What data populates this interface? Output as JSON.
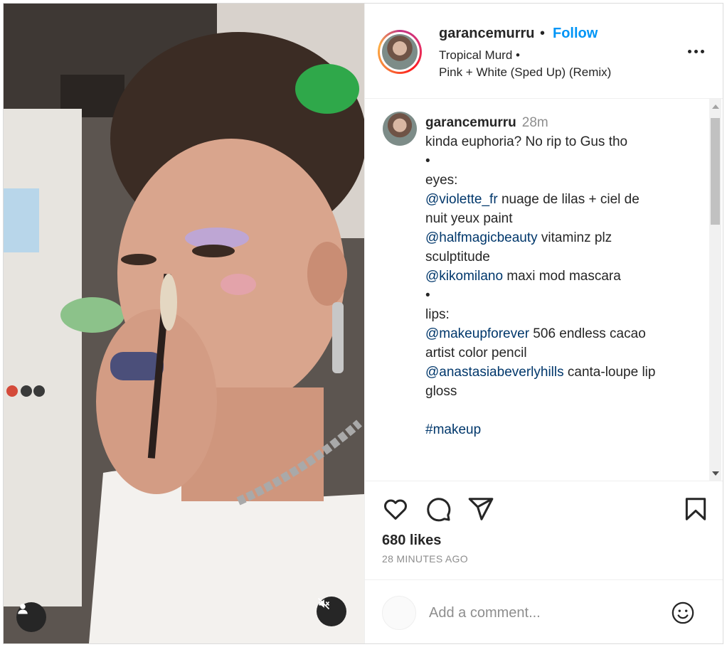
{
  "post": {
    "username": "garancemurru",
    "follow_label": "Follow",
    "separator": "•",
    "audio_line1": "Tropical Murd •",
    "audio_line2": "Pink + White (Sped Up) (Remix)"
  },
  "caption": {
    "username": "garancemurru",
    "time": "28m",
    "lines": [
      "kinda euphoria? No rip to Gus tho",
      "•",
      "eyes:",
      "@violette_fr",
      " nuage de lilas + ciel de",
      "nuit yeux paint",
      "@halfmagicbeauty",
      " vitaminz plz",
      "sculptitude",
      "@kikomilano",
      " maxi mod mascara",
      "•",
      "lips:",
      "@makeupforever",
      " 506 endless cacao",
      "artist color pencil",
      "@anastasiabeverlyhills",
      " canta-loupe lip",
      "gloss",
      "#makeup"
    ]
  },
  "engagement": {
    "likes": "680 likes",
    "posted": "28 MINUTES AGO"
  },
  "comment_box": {
    "placeholder": "Add a comment..."
  },
  "icons": {
    "like": "heart-icon",
    "comment": "comment-icon",
    "share": "paper-plane-icon",
    "save": "bookmark-icon",
    "emoji": "smiley-icon",
    "tags": "user-tag-icon",
    "mute": "muted-speaker-icon",
    "more": "more-options-icon"
  },
  "colors": {
    "accent": "#0095f6",
    "mention": "#00376b",
    "muted_text": "#8e8e8e"
  }
}
